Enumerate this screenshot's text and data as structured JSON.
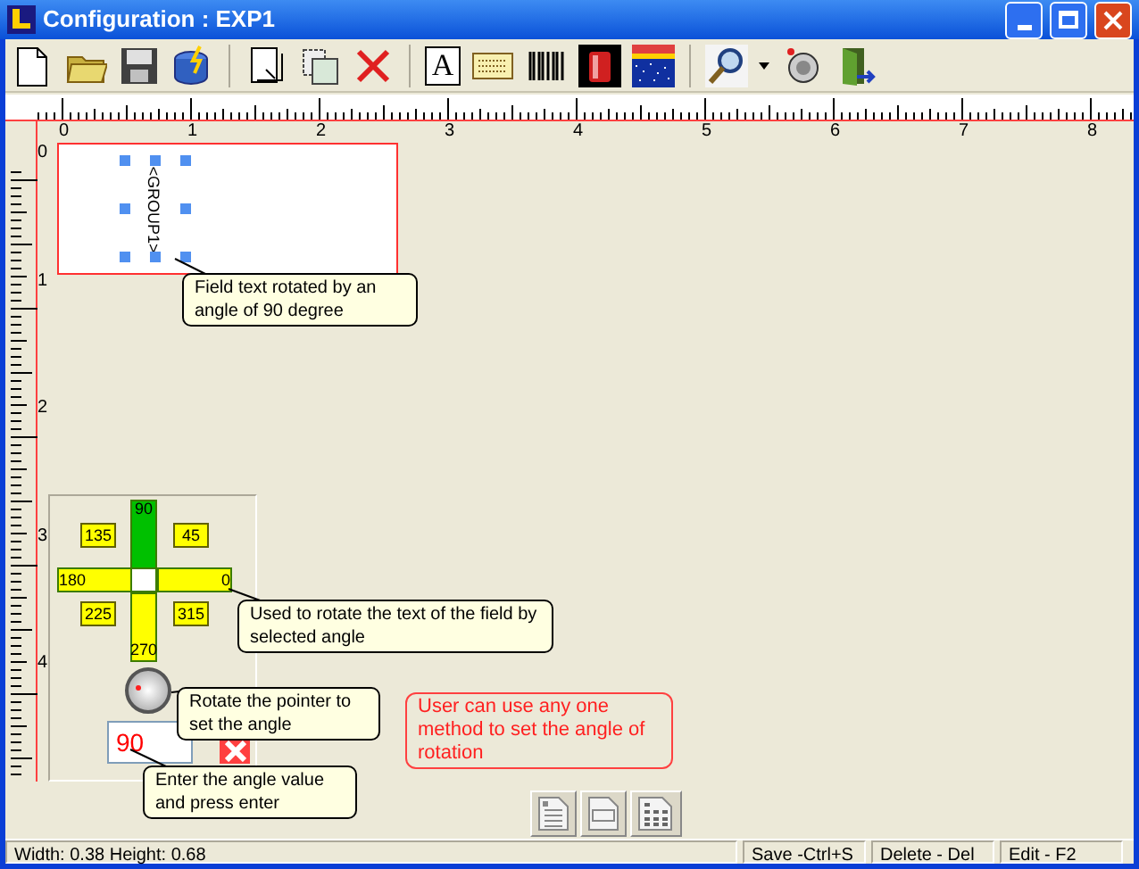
{
  "window": {
    "title": "Configuration : EXP1"
  },
  "toolbar": {
    "text_tool_glyph": "A"
  },
  "ruler": {
    "horizontal_labels": [
      "0",
      "1",
      "2",
      "3",
      "4",
      "5",
      "6",
      "7",
      "8"
    ],
    "vertical_labels": [
      "0",
      "1",
      "2",
      "3",
      "4"
    ]
  },
  "label": {
    "field_text": "<GROUP1>",
    "selected": true
  },
  "angle_arms": [
    {
      "label": "90",
      "selected": true
    },
    {
      "label": "180",
      "selected": false
    },
    {
      "label": "0",
      "selected": false
    },
    {
      "label": "270",
      "selected": false
    }
  ],
  "angle_diagonals": [
    {
      "label": "135",
      "selected": false
    },
    {
      "label": "45",
      "selected": false
    },
    {
      "label": "225",
      "selected": false
    },
    {
      "label": "315",
      "selected": false
    }
  ],
  "angle_input": {
    "value": "90"
  },
  "callouts": [
    {
      "text": "Field text rotated by an angle of 90 degree"
    },
    {
      "text": "Used to rotate the text of the field by selected angle"
    },
    {
      "text": "Rotate the pointer to set the angle"
    },
    {
      "text": "Enter the angle value and press enter"
    }
  ],
  "note": "User can use any one method to set the angle of rotation",
  "status_bar": {
    "size": "Width: 0.38 Height: 0.68",
    "shortcuts": [
      "Save -Ctrl+S",
      "Delete - Del",
      "Edit - F2"
    ]
  }
}
